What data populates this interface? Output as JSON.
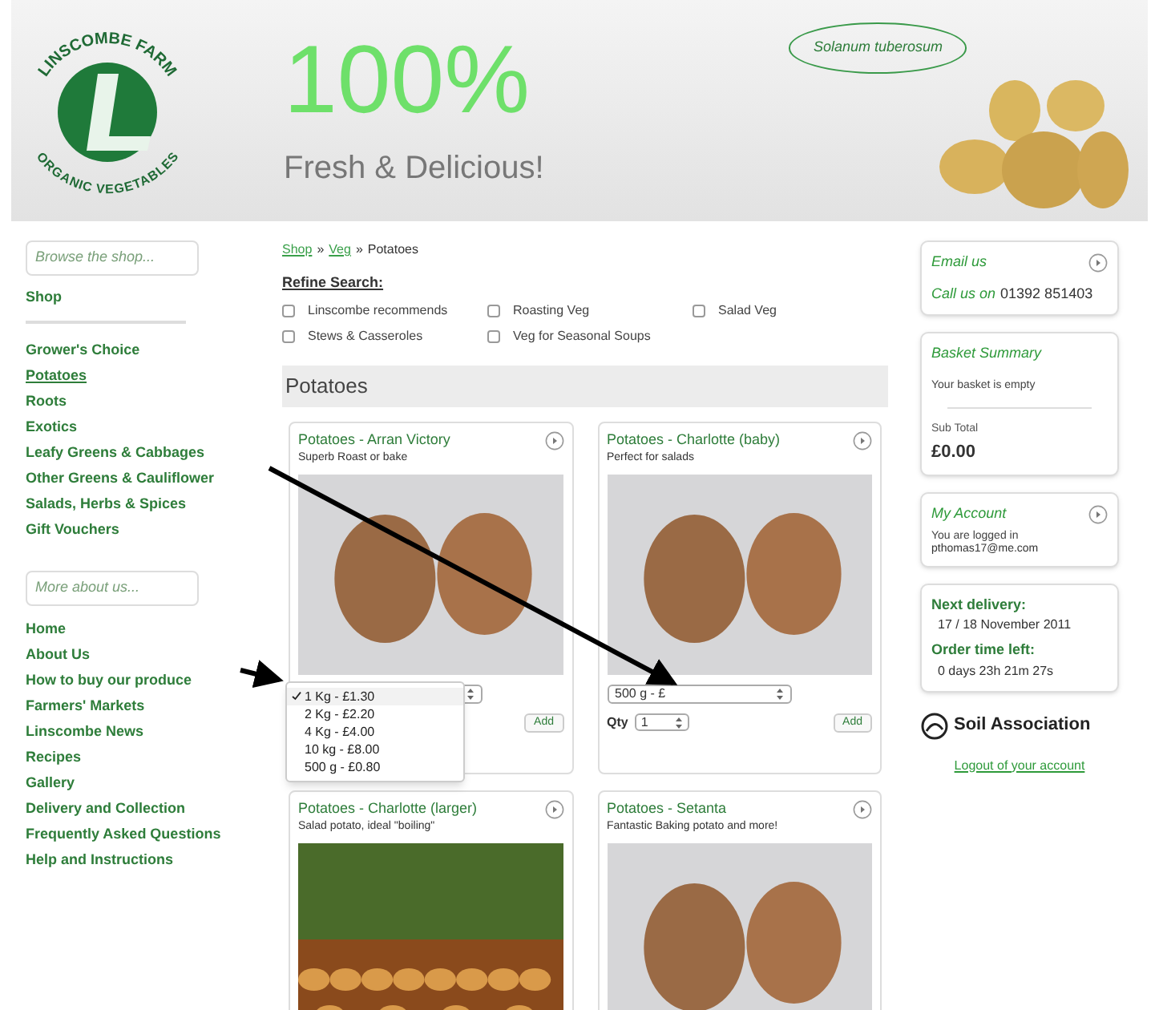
{
  "header": {
    "logo_top": "LINSCOMBE FARM",
    "logo_bottom": "ORGANIC VEGETABLES",
    "headline": "100%",
    "tagline": "Fresh & Delicious!",
    "latin_label": "Solanum tuberosum"
  },
  "sidebar": {
    "browse_heading": "Browse the shop...",
    "shop_link": "Shop",
    "shop_items": [
      {
        "label": "Grower's Choice",
        "selected": false
      },
      {
        "label": "Potatoes",
        "selected": true
      },
      {
        "label": "Roots",
        "selected": false
      },
      {
        "label": "Exotics",
        "selected": false
      },
      {
        "label": "Leafy Greens & Cabbages",
        "selected": false
      },
      {
        "label": "Other Greens & Cauliflower",
        "selected": false
      },
      {
        "label": "Salads, Herbs & Spices",
        "selected": false
      },
      {
        "label": "Gift Vouchers",
        "selected": false
      }
    ],
    "about_heading": "More about us...",
    "about_items": [
      "Home",
      "About Us",
      "How to buy our produce",
      "Farmers' Markets",
      "Linscombe News",
      "Recipes",
      "Gallery",
      "Delivery and Collection",
      "Frequently Asked Questions",
      "Help and Instructions"
    ]
  },
  "breadcrumb": [
    {
      "label": "Shop",
      "link": true
    },
    {
      "label": "Veg",
      "link": true
    },
    {
      "label": "Potatoes",
      "link": false
    }
  ],
  "breadcrumb_separator": "»",
  "refine": {
    "title": "Refine Search:",
    "options": [
      {
        "label": "Linscombe recommends",
        "checked": false
      },
      {
        "label": "Roasting Veg",
        "checked": false
      },
      {
        "label": "Salad Veg",
        "checked": false
      },
      {
        "label": "Stews & Casseroles",
        "checked": false
      },
      {
        "label": "Veg for Seasonal Soups",
        "checked": false
      }
    ]
  },
  "section_title": "Potatoes",
  "products": [
    {
      "title": "Potatoes - Arran Victory",
      "subtitle": "Superb Roast or bake",
      "kind": "potatoes",
      "add": "Add",
      "options": [
        {
          "label": "1 Kg - £1.30",
          "selected": true
        },
        {
          "label": "2 Kg - £2.20",
          "selected": false
        },
        {
          "label": "4 Kg - £4.00",
          "selected": false
        },
        {
          "label": "10 kg - £8.00",
          "selected": false
        },
        {
          "label": "500 g - £0.80",
          "selected": false
        }
      ]
    },
    {
      "title": "Potatoes - Charlotte (baby)",
      "subtitle": "Perfect for salads",
      "kind": "potatoes",
      "weight": "500 g - £",
      "qty_label": "Qty",
      "qty": "1",
      "add": "Add"
    },
    {
      "title": "Potatoes - Charlotte (larger)",
      "subtitle": "Salad potato, ideal \"boiling\"",
      "kind": "harvest"
    },
    {
      "title": "Potatoes - Setanta",
      "subtitle": "Fantastic Baking potato and more!",
      "kind": "potatoes"
    }
  ],
  "contact": {
    "email": "Email us",
    "call": "Call us on",
    "phone": "01392 851403"
  },
  "basket": {
    "title": "Basket Summary",
    "status": "Your basket is empty",
    "subtotal_label": "Sub Total",
    "subtotal": "£0.00"
  },
  "account": {
    "title": "My Account",
    "status": "You are logged in",
    "email": "pthomas17@me.com"
  },
  "delivery": {
    "next_label": "Next delivery:",
    "next": "17 / 18 November 2011",
    "time_label": "Order time left:",
    "time": "0 days 23h 21m 27s"
  },
  "soil": {
    "name": "Soil Association"
  },
  "logout": "Logout of your account"
}
